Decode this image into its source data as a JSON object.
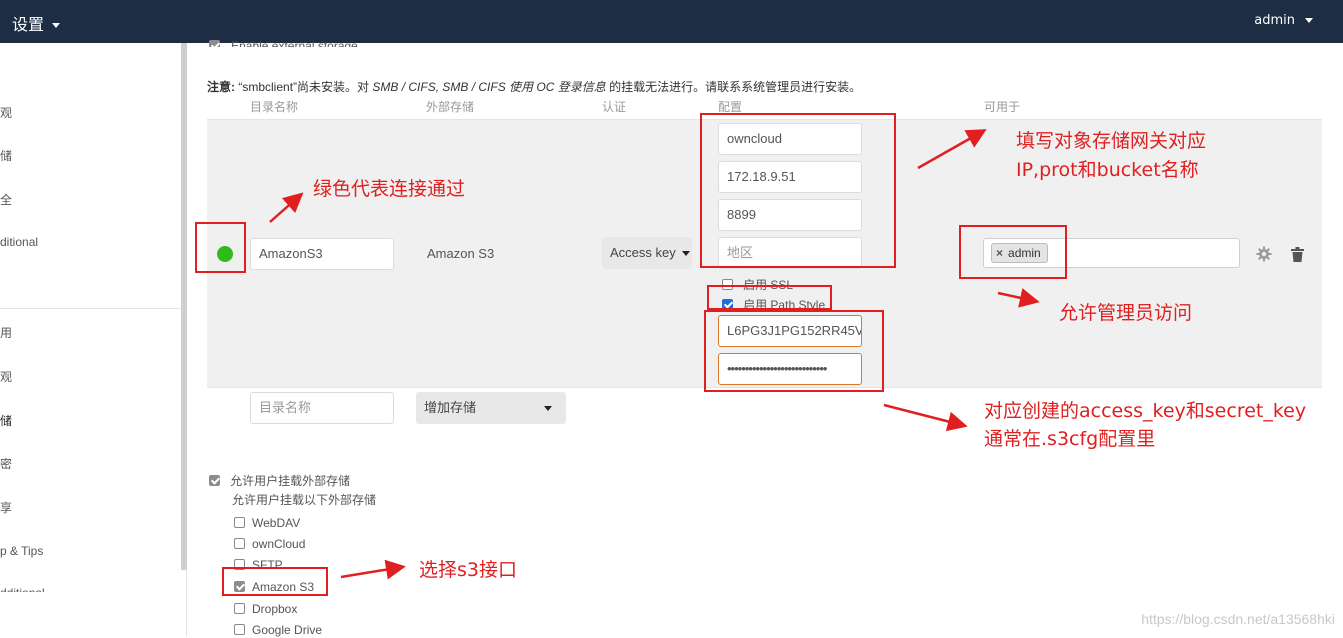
{
  "header": {
    "app_menu": "设置",
    "user_menu": "admin"
  },
  "sidebar": {
    "items": [
      "观",
      "储",
      "全",
      "ditional",
      "用",
      "观",
      "储",
      "密",
      "享",
      "p & Tips",
      "dditional"
    ]
  },
  "main": {
    "enable_external_storage": "Enable external storage",
    "note": {
      "label": "注意:",
      "text_1": "“smbclient”尚未安装。对",
      "text_italic": "SMB / CIFS, SMB / CIFS 使用 OC 登录信息",
      "text_2": "的挂载无法进行。请联系系统管理员进行安装。"
    },
    "columns": {
      "folder": "目录名称",
      "external": "外部存储",
      "auth": "认证",
      "config": "配置",
      "available": "可用于"
    },
    "mount": {
      "status": "ok",
      "folder_name": "AmazonS3",
      "backend": "Amazon S3",
      "auth": "Access key",
      "config": {
        "bucket": "owncloud",
        "hostname": "172.18.9.51",
        "port": "8899",
        "region_placeholder": "地区",
        "enable_ssl_label": "启用 SSL",
        "enable_ssl": false,
        "path_style_label": "启用 Path Style",
        "path_style": true,
        "access_key": "L6PG3J1PG152RR45V'",
        "secret_key": "••••••••••••••••••••••••••••"
      },
      "applicable_users": [
        "admin"
      ]
    },
    "new_mount": {
      "folder_placeholder": "目录名称",
      "add_storage": "增加存储"
    },
    "allow_user_mount": {
      "label": "允许用户挂载外部存储",
      "checked": true,
      "sub_label": "允许用户挂载以下外部存储",
      "backends": [
        {
          "label": "WebDAV",
          "checked": false
        },
        {
          "label": "ownCloud",
          "checked": false
        },
        {
          "label": "SFTP",
          "checked": false
        },
        {
          "label": "Amazon S3",
          "checked": true
        },
        {
          "label": "Dropbox",
          "checked": false
        },
        {
          "label": "Google Drive",
          "checked": false
        }
      ]
    }
  },
  "annotations": {
    "green_ok": "绿色代表连接通过",
    "fill_gateway_1": "填写对象存储网关对应",
    "fill_gateway_2": "IP,prot和bucket名称",
    "allow_admin": "允许管理员访问",
    "keys_1": "对应创建的access_key和secret_key",
    "keys_2": "通常在.s3cfg配置里",
    "select_s3": "选择s3接口"
  },
  "colors": {
    "topbar": "#1d2d44",
    "status_ok": "#2ebd18",
    "annotation": "#e02020"
  },
  "watermark": "https://blog.csdn.net/a13568hki"
}
